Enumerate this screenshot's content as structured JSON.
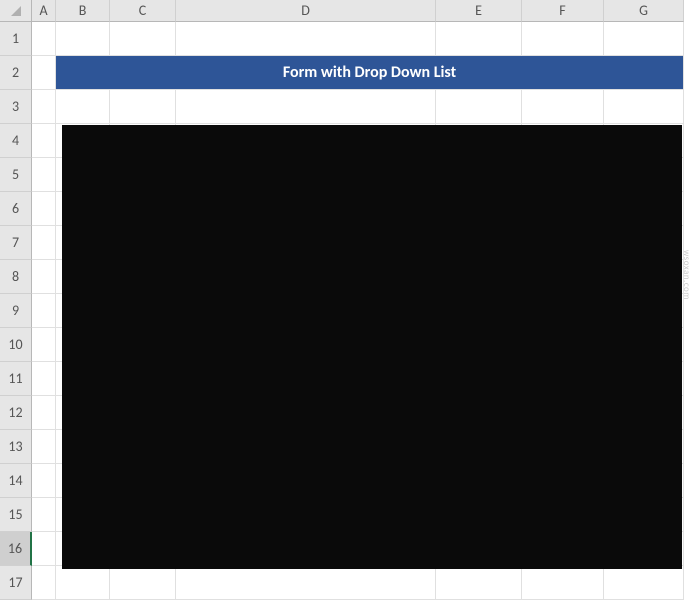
{
  "columns": [
    "A",
    "B",
    "C",
    "D",
    "E",
    "F",
    "G"
  ],
  "rows": [
    "1",
    "2",
    "3",
    "4",
    "5",
    "6",
    "7",
    "8",
    "9",
    "10",
    "11",
    "12",
    "13",
    "14",
    "15",
    "16",
    "17"
  ],
  "selected_row": "16",
  "title_cell": "Form with Drop Down List",
  "watermark": "wsoxan.com"
}
